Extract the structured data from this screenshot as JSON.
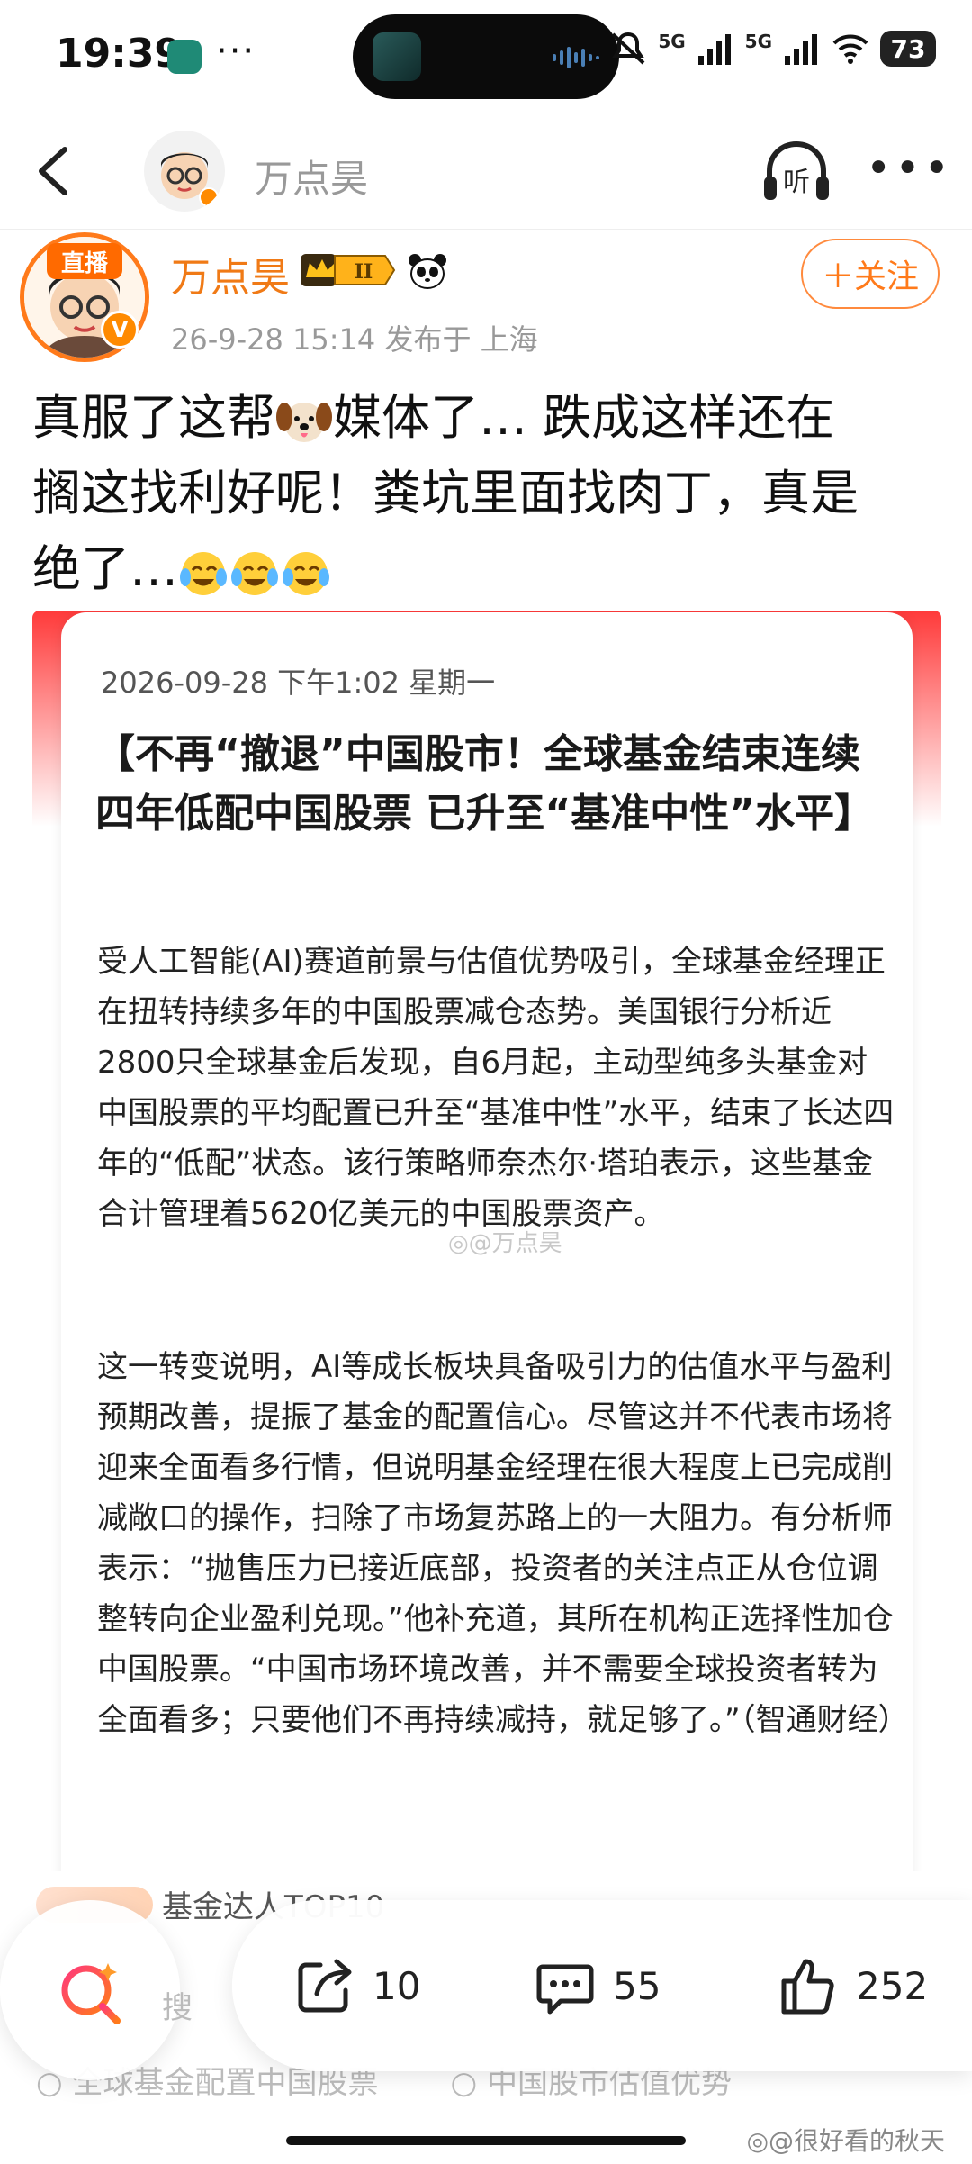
{
  "status_bar": {
    "time": "19:39",
    "dots": "···",
    "network_1": "5G",
    "network_2": "5G",
    "battery": "73",
    "icons": [
      "app-icon",
      "mute-bell-icon",
      "signal-icon",
      "wifi-icon",
      "battery-icon"
    ]
  },
  "header": {
    "name": "万点昊",
    "listen_label": "听"
  },
  "author": {
    "name": "万点昊",
    "live_badge": "直播",
    "verified_mark": "V",
    "level_badge": "II",
    "meta": "26-9-28 15:14  发布于 上海",
    "follow_label": "＋关注"
  },
  "post": {
    "line1": "真服了这帮",
    "line1b": "媒体了… 跌成这样还在",
    "line2": "搁这找利好呢！粪坑里面找肉丁，真是",
    "line3": "绝了…"
  },
  "image_card": {
    "date": "2026-09-28 下午1:02 星期一",
    "title": "【不再“撤退”中国股市！全球基金结束连续四年低配中国股票 已升至“基准中性”水平】",
    "para1": "受人工智能(AI)赛道前景与估值优势吸引，全球基金经理正在扭转持续多年的中国股票减仓态势。美国银行分析近2800只全球基金后发现，自6月起，主动型纯多头基金对中国股票的平均配置已升至“基准中性”水平，结束了长达四年的“低配”状态。该行策略师奈杰尔·塔珀表示，这些基金合计管理着5620亿美元的中国股票资产。",
    "para2": "这一转变说明，AI等成长板块具备吸引力的估值水平与盈利预期改善，提振了基金的配置信心。尽管这并不代表市场将迎来全面看多行情，但说明基金经理在很大程度上已完成削减敞口的操作，扫除了市场复苏路上的一大阻力。有分析师表示：“抛售压力已接近底部，投资者的关注点正从仓位调整转向企业盈利兑现。”他补充道，其所在机构正选择性加仓中国股票。“中国市场环境改善，并不需要全球投资者转为全面看多；只要他们不再持续减持，就足够了。”（智通财经）",
    "watermark": "◎@万点昊"
  },
  "below": {
    "tag": "基金达人TOP10",
    "search_label": "搜",
    "hint1": "全球基金配置中国股票",
    "hint2": "中国股市估值优势"
  },
  "actions": {
    "share_count": "10",
    "comment_count": "55",
    "like_count": "252"
  },
  "corner_watermark": "◎@很好看的秋天",
  "colors": {
    "accent_orange": "#ff7a1a",
    "red_banner": "#ff3a3a"
  }
}
